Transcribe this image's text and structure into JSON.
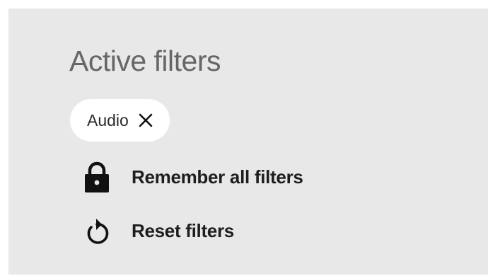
{
  "filters": {
    "title": "Active filters",
    "chips": [
      {
        "label": "Audio",
        "icon": "close-icon"
      }
    ],
    "actions": {
      "remember": {
        "label": "Remember all filters",
        "icon": "lock-icon"
      },
      "reset": {
        "label": "Reset filters",
        "icon": "reset-icon"
      }
    }
  },
  "colors": {
    "panel_background": "#e8e8e8",
    "title_text": "#666666",
    "chip_background": "#ffffff",
    "action_text": "#1e1e1e",
    "icon": "#111111"
  }
}
